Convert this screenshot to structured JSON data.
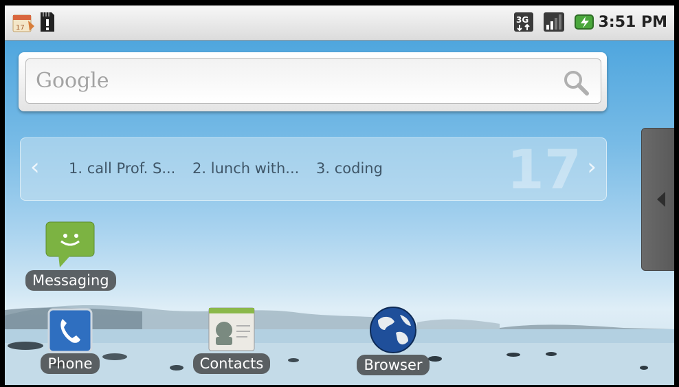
{
  "status_bar": {
    "time": "3:51 PM",
    "network_type": "3G",
    "icons": [
      "calendar-icon",
      "sd-card-warning-icon",
      "3g-icon",
      "signal-icon",
      "battery-charging-icon"
    ]
  },
  "search": {
    "placeholder": "Google"
  },
  "calendar_widget": {
    "tasks": [
      "1. call Prof. S...",
      "2. lunch with...",
      "3. coding"
    ],
    "date": "17",
    "prev_arrow": "‹",
    "next_arrow": "›"
  },
  "apps": {
    "messaging": "Messaging",
    "phone": "Phone",
    "contacts": "Contacts",
    "browser": "Browser"
  },
  "colors": {
    "messaging_green": "#7cb342",
    "phone_blue": "#2f6fc0",
    "label_bg": "#3c3c3c"
  }
}
